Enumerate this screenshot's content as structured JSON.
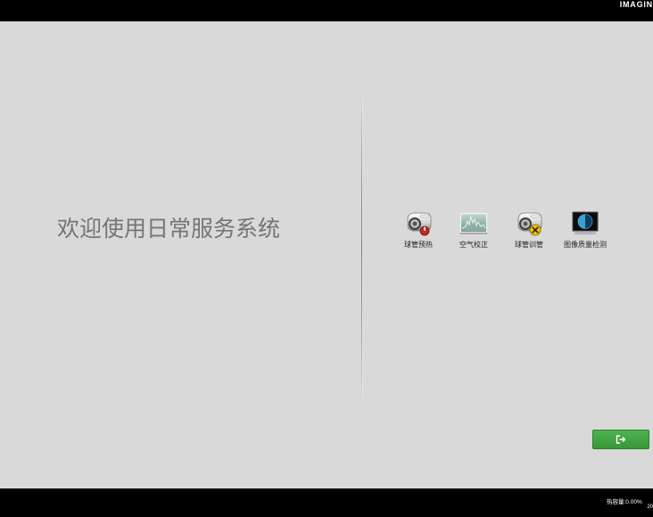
{
  "header": {
    "brand": "IMAGIN"
  },
  "welcome": {
    "title": "欢迎使用日常服务系统"
  },
  "services": [
    {
      "label": "球管预热",
      "icon": "tube-warmup-icon"
    },
    {
      "label": "空气校正",
      "icon": "air-calibration-icon"
    },
    {
      "label": "球管训管",
      "icon": "tube-seasoning-icon"
    },
    {
      "label": "图像质量检测",
      "icon": "image-quality-icon"
    }
  ],
  "exit_button": {
    "icon": "exit-icon"
  },
  "footer": {
    "heat_capacity": "热容量:0.00%",
    "datetime": "20"
  },
  "colors": {
    "background": "#d9d9d9",
    "bars": "#000000",
    "accent": "#3e9f3e",
    "title_text": "#757575"
  }
}
